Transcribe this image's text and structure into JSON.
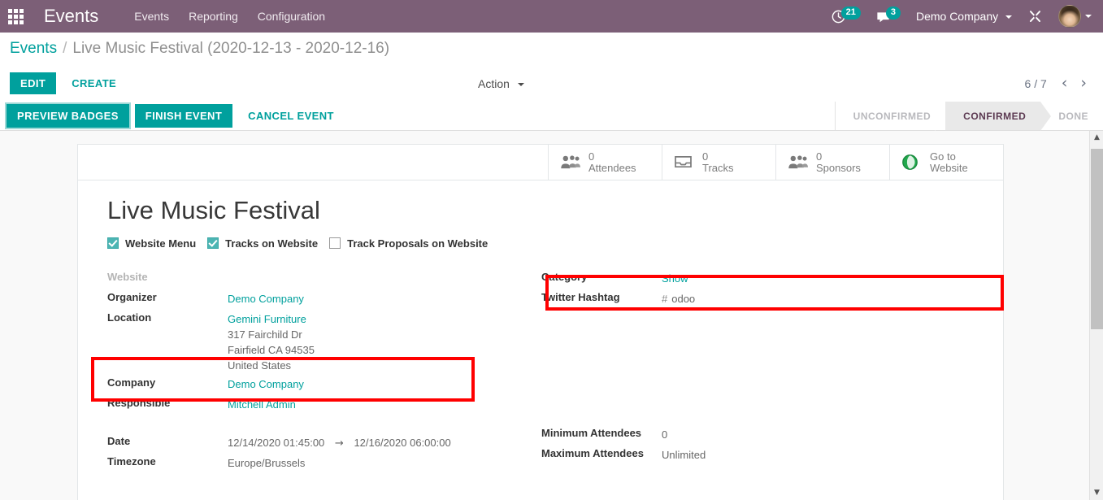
{
  "navbar": {
    "apps_icon": "apps-grid-icon",
    "app_title": "Events",
    "menu": [
      {
        "label": "Events"
      },
      {
        "label": "Reporting"
      },
      {
        "label": "Configuration"
      }
    ],
    "systray": {
      "activities_icon": "clock-icon",
      "activities_count": "21",
      "messages_icon": "chat-bubble-icon",
      "messages_count": "3",
      "company": "Demo Company",
      "debug_icon": "tools-wrench-icon",
      "avatar_icon": "user-avatar"
    },
    "accent_color": "#7c5f77",
    "badge_color": "#00a09d"
  },
  "breadcrumb": {
    "root": "Events",
    "separator": "/",
    "current": "Live Music Festival (2020-12-13 - 2020-12-16)"
  },
  "control_panel": {
    "edit_label": "EDIT",
    "create_label": "CREATE",
    "action_label": "Action",
    "pager_value": "6 / 7",
    "pager_prev_icon": "chevron-left-icon",
    "pager_next_icon": "chevron-right-icon"
  },
  "workflow": {
    "buttons": [
      {
        "label": "PREVIEW BADGES",
        "style": "primary-focused"
      },
      {
        "label": "FINISH EVENT",
        "style": "primary"
      },
      {
        "label": "CANCEL EVENT",
        "style": "link"
      }
    ],
    "statusbar": [
      {
        "label": "UNCONFIRMED",
        "active": false
      },
      {
        "label": "CONFIRMED",
        "active": true
      },
      {
        "label": "DONE",
        "active": false
      }
    ]
  },
  "stat_buttons": [
    {
      "value": "0",
      "label": "Attendees",
      "icon": "users-icon"
    },
    {
      "value": "0",
      "label": "Tracks",
      "icon": "inbox-tray-icon"
    },
    {
      "value": "0",
      "label": "Sponsors",
      "icon": "users-icon"
    },
    {
      "value": "Go to",
      "label": "Website",
      "icon": "globe-icon"
    }
  ],
  "record": {
    "title": "Live Music Festival",
    "checkboxes": [
      {
        "label": "Website Menu",
        "checked": true
      },
      {
        "label": "Tracks on Website",
        "checked": true
      },
      {
        "label": "Track Proposals on Website",
        "checked": false
      }
    ],
    "left_fields": {
      "website_label": "Website",
      "website_value": "",
      "organizer_label": "Organizer",
      "organizer_value": "Demo Company",
      "location_label": "Location",
      "location_name": "Gemini Furniture",
      "location_street": "317 Fairchild Dr",
      "location_city": "Fairfield CA 94535",
      "location_country": "United States",
      "company_label": "Company",
      "company_value": "Demo Company",
      "responsible_label": "Responsible",
      "responsible_value": "Mitchell Admin",
      "date_label": "Date",
      "date_start": "12/14/2020 01:45:00",
      "date_arrow": "→",
      "date_end": "12/16/2020 06:00:00",
      "timezone_label": "Timezone",
      "timezone_value": "Europe/Brussels"
    },
    "right_fields": {
      "category_label": "Category",
      "category_value": "Show",
      "hashtag_label": "Twitter Hashtag",
      "hashtag_symbol": "#",
      "hashtag_value": "odoo",
      "min_attendees_label": "Minimum Attendees",
      "min_attendees_value": "0",
      "max_attendees_label": "Maximum Attendees",
      "max_attendees_value": "Unlimited"
    }
  },
  "highlights": {
    "stat_buttons_box_color": "#ff0000",
    "checkbox_row_box_color": "#ff0000"
  },
  "scrollbar": {
    "up_icon": "chevron-up-icon",
    "down_icon": "chevron-down-icon"
  }
}
